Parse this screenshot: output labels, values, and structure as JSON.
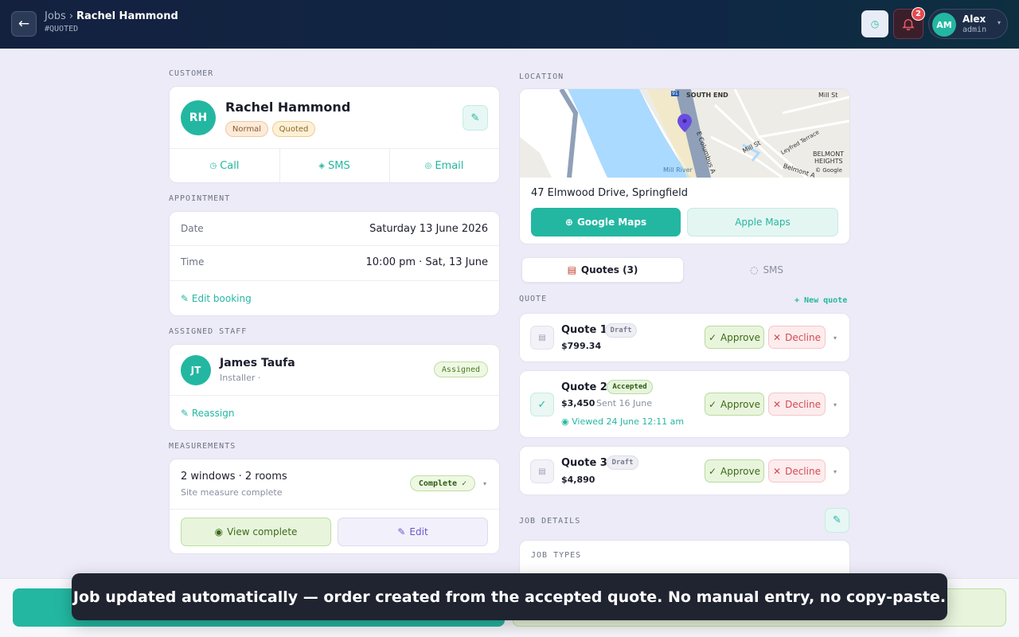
{
  "header": {
    "crumb_parent": "Jobs",
    "crumb_current": "Rachel Hammond",
    "job_tag": "#QUOTED",
    "notification_count": "2",
    "user": {
      "initials": "AM",
      "name": "Alex",
      "role": "admin"
    }
  },
  "customer": {
    "section_label": "CUSTOMER",
    "initials": "RH",
    "name": "Rachel Hammond",
    "badges": [
      "Normal",
      "Quoted"
    ],
    "actions": {
      "call": "Call",
      "sms": "SMS",
      "email": "Email"
    }
  },
  "appointment": {
    "section_label": "APPOINTMENT",
    "date_label": "Date",
    "date_value": "Saturday 13 June 2026",
    "time_label": "Time",
    "time_value": "10:00 pm · Sat, 13 June",
    "edit_label": "Edit booking"
  },
  "staff": {
    "section_label": "ASSIGNED STAFF",
    "initials": "JT",
    "name": "James Taufa",
    "role": "Installer ·",
    "status": "Assigned",
    "reassign_label": "Reassign"
  },
  "measurements": {
    "section_label": "MEASUREMENTS",
    "summary": "2 windows · 2 rooms",
    "sub": "Site measure complete",
    "status": "Complete ✓",
    "view_label": "View complete",
    "edit_label": "Edit"
  },
  "location": {
    "section_label": "LOCATION",
    "address": "47 Elmwood Drive, Springfield",
    "google_label": "Google Maps",
    "apple_label": "Apple Maps",
    "map_labels": {
      "south_end": "SOUTH END",
      "mill_st_top": "Mill St",
      "mill_st": "Mill St",
      "belmont": "BELMONT",
      "heights": "HEIGHTS",
      "mill_river": "Mill River",
      "columbus": "E Columbus A",
      "leyfred": "Leyfred Terrace",
      "belmont_ave": "Belmont A",
      "google": "© Google",
      "route": "91"
    }
  },
  "tabs": {
    "quotes": "Quotes (3)",
    "sms": "SMS"
  },
  "quotes": {
    "section_label": "QUOTE",
    "new_label": "+ New quote",
    "items": [
      {
        "title": "Quote 1",
        "status": "Draft",
        "price": "$799.34",
        "approve": "Approve",
        "decline": "Decline"
      },
      {
        "title": "Quote 2",
        "status": "Accepted",
        "price": "$3,450",
        "sent": "Sent 16 June",
        "viewed": "Viewed 24 June 12:11 am",
        "approve": "Approve",
        "decline": "Decline"
      },
      {
        "title": "Quote 3",
        "status": "Draft",
        "price": "$4,890",
        "approve": "Approve",
        "decline": "Decline"
      }
    ]
  },
  "job_details": {
    "section_label": "JOB DETAILS",
    "job_types_label": "JOB TYPES"
  },
  "toast": {
    "message": "Job updated automatically — order created from the accepted quote. No manual entry, no copy-paste."
  },
  "colors": {
    "accent": "#23b7a1",
    "header_bg": "#13213f",
    "approve": "#3d6a1a",
    "decline": "#d34a52"
  }
}
